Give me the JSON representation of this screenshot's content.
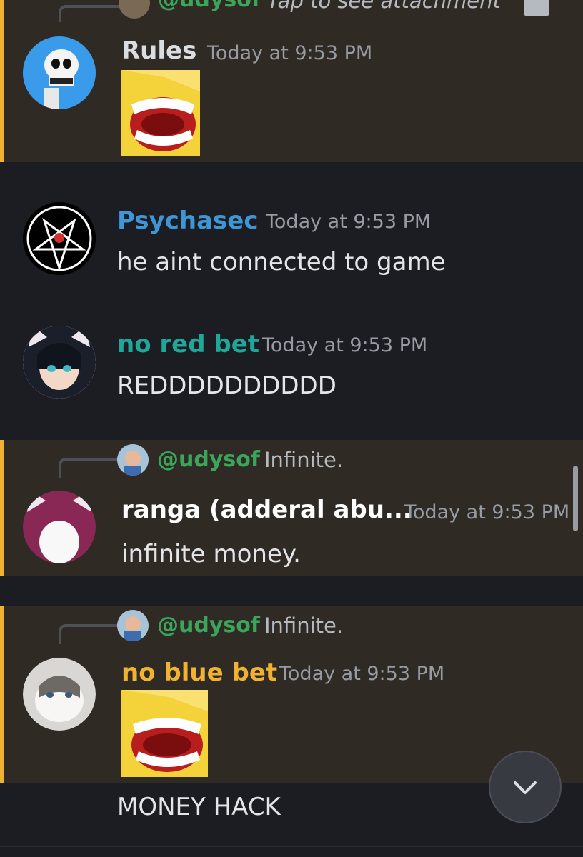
{
  "top_reply": {
    "name": "@udysof",
    "text": "Tap to see attachment",
    "icon": "image-icon"
  },
  "messages": [
    {
      "author": "Rules",
      "author_color": "#ffffff",
      "timestamp": "Today at 9:53 PM",
      "content": "",
      "attachment": "screaming-face-emoji"
    },
    {
      "author": "Psychasec",
      "author_color": "#3f96d6",
      "timestamp": "Today at 9:53 PM",
      "content": "he aint connected to game"
    },
    {
      "author": "no red bet",
      "author_color": "#1fa89a",
      "timestamp": "Today at 9:53 PM",
      "content": "REDDDDDDDDDD"
    },
    {
      "reply_to": "@udysof",
      "reply_text": "Infinite.",
      "author": "ranga (adderal abu...",
      "author_color": "#ffffff",
      "timestamp": "Today at 9:53 PM",
      "content": "infinite money."
    },
    {
      "reply_to": "@udysof",
      "reply_text": "Infinite.",
      "author": "no blue bet",
      "author_color": "#f0b232",
      "timestamp": "Today at 9:53 PM",
      "content": "",
      "attachment": "screaming-face-emoji"
    },
    {
      "content": "MONEY HACK"
    }
  ],
  "colors": {
    "background": "#1c1d22",
    "mention_background": "#2f2a24",
    "mention_bar": "#f0b232",
    "reply_name": "#3ba55c",
    "timestamp": "#979ba3"
  },
  "jump_button_icon": "chevron-down-icon"
}
